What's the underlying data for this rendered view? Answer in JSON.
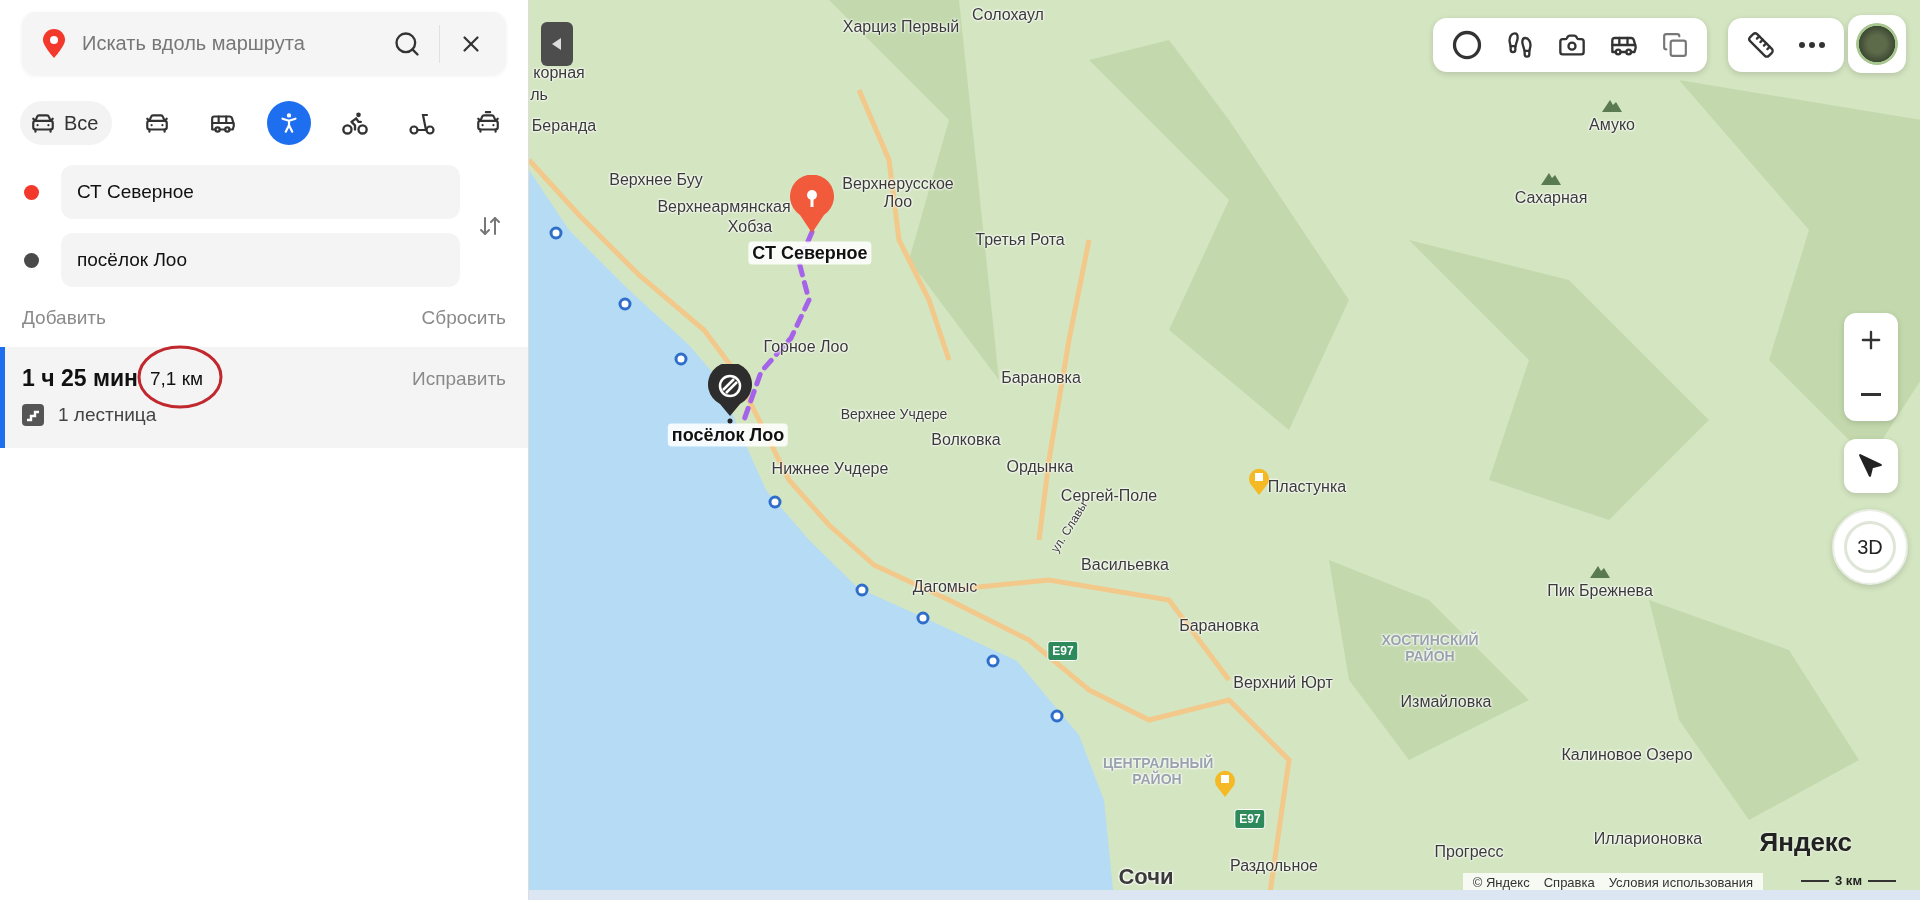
{
  "search": {
    "placeholder": "Искать вдоль маршрута"
  },
  "modes": [
    {
      "kind": "all",
      "label": "Все",
      "selected": false
    },
    {
      "kind": "car",
      "selected": false
    },
    {
      "kind": "bus",
      "selected": false
    },
    {
      "kind": "walk",
      "selected": true
    },
    {
      "kind": "bike",
      "selected": false
    },
    {
      "kind": "scooter",
      "selected": false
    },
    {
      "kind": "taxi",
      "selected": false
    }
  ],
  "waypoints": [
    {
      "value": "СТ Северное",
      "color": "#f2392c"
    },
    {
      "value": "посёлок Лоо",
      "color": "#4a4a4a"
    }
  ],
  "actions": {
    "add": "Добавить",
    "reset": "Сбросить"
  },
  "route": {
    "duration": "1 ч 25 мин",
    "distance": "7,1 км",
    "fix": "Исправить",
    "feature": "1 лестница",
    "selected": true
  },
  "map": {
    "labels": [
      {
        "text": "Солохаул",
        "kind": "place"
      },
      {
        "text": "Харциз Первый",
        "kind": "place"
      },
      {
        "text": "корная",
        "kind": "place"
      },
      {
        "text": "ль",
        "kind": "place"
      },
      {
        "text": "Беранда",
        "kind": "place"
      },
      {
        "text": "Верхнее Буу",
        "kind": "place"
      },
      {
        "text": "Верхнерусское Лоо",
        "kind": "place"
      },
      {
        "text": "Верхнеармянская",
        "kind": "place"
      },
      {
        "text": "Хобза",
        "kind": "place"
      },
      {
        "text": "СТ Северное",
        "kind": "point"
      },
      {
        "text": "Третья Рота",
        "kind": "place"
      },
      {
        "text": "Горное Лоо",
        "kind": "place"
      },
      {
        "text": "Барановка",
        "kind": "place"
      },
      {
        "text": "Верхнее Учдере",
        "kind": "small"
      },
      {
        "text": "Волковка",
        "kind": "place"
      },
      {
        "text": "посёлок Лоо",
        "kind": "point"
      },
      {
        "text": "Ордынка",
        "kind": "place"
      },
      {
        "text": "Нижнее Учдере",
        "kind": "place"
      },
      {
        "text": "Пластунка",
        "kind": "place"
      },
      {
        "text": "Сергей-Поле",
        "kind": "place"
      },
      {
        "text": "ул. Славы",
        "kind": "street"
      },
      {
        "text": "Васильевка",
        "kind": "place"
      },
      {
        "text": "Дагомыс",
        "kind": "place"
      },
      {
        "text": "Барановка",
        "kind": "place"
      },
      {
        "text": "ХОСТИНСКИЙ РАЙОН",
        "kind": "district"
      },
      {
        "text": "Верхний Юрт",
        "kind": "place"
      },
      {
        "text": "Измайловка",
        "kind": "place"
      },
      {
        "text": "ЦЕНТРАЛЬНЫЙ РАЙОН",
        "kind": "district"
      },
      {
        "text": "Калиновое Озеро",
        "kind": "place"
      },
      {
        "text": "Илларионовка",
        "kind": "place"
      },
      {
        "text": "Прогресс",
        "kind": "place"
      },
      {
        "text": "Раздольное",
        "kind": "place"
      },
      {
        "text": "Сочи",
        "kind": "city"
      },
      {
        "text": "Амуко",
        "kind": "peak"
      },
      {
        "text": "Сахарная",
        "kind": "peak"
      },
      {
        "text": "Пик Брежнева",
        "kind": "peak"
      }
    ],
    "highways": [
      "E97",
      "E97"
    ],
    "compass": "3D",
    "logo": "Яндекс",
    "attribution": [
      "© Яндекс",
      "Справка",
      "Условия использования"
    ],
    "scale": "3 км"
  }
}
